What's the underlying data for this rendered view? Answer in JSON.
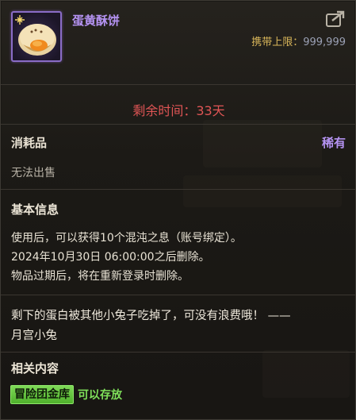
{
  "item": {
    "name": "蛋黄酥饼",
    "icon": "egg-yolk-pastry-icon",
    "frame_color": "#8a6cc6"
  },
  "share": {
    "icon": "share-icon"
  },
  "carry": {
    "label": "携带上限：",
    "value": "999,999"
  },
  "remaining": "剩余时间：33天",
  "category": {
    "type": "消耗品",
    "rarity": "稀有"
  },
  "sell_status": "无法出售",
  "basic_info": {
    "title": "基本信息",
    "lines": [
      "使用后，可以获得10个混沌之息（账号绑定）。",
      "2024年10月30日 06:00:00之后删除。",
      "物品过期后，将在重新登录时删除。"
    ]
  },
  "flavor": {
    "lines": [
      "剩下的蛋白被其他小兔子吃掉了，可没有浪费哦！ ——",
      "月宫小兔"
    ]
  },
  "related": {
    "title": "相关内容",
    "tag": "冒险团金库",
    "tag_text": "可以存放"
  },
  "colors": {
    "name_purple": "#b593f2",
    "remaining_red": "#e05555",
    "carry_gold": "#d9b65a",
    "store_green": "#7fe05a"
  }
}
